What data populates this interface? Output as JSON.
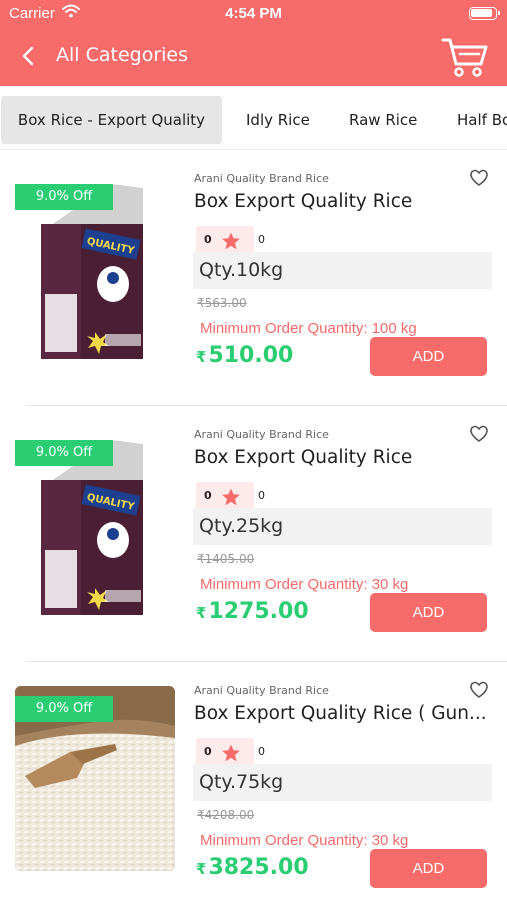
{
  "status_bar": {
    "carrier": "Carrier",
    "time": "4:54 PM"
  },
  "header": {
    "title": "All Categories",
    "back_icon": "chevron-left-icon",
    "cart_icon": "cart-icon",
    "color": "#f76b6a"
  },
  "tabs": [
    {
      "label": "Box Rice - Export Quality",
      "active": true
    },
    {
      "label": "Idly Rice",
      "active": false
    },
    {
      "label": "Raw Rice",
      "active": false
    },
    {
      "label": "Half Bo",
      "active": false
    }
  ],
  "products": [
    {
      "image": "rice-bag-quality",
      "discount": "9.0% Off",
      "brand": "Arani Quality Brand Rice",
      "name": "Box Export Quality Rice",
      "rating_left": "0",
      "rating_right": "0",
      "qty": "Qty.10kg",
      "mrp": "₹563.00",
      "min_order": "Minimum Order Quantity: 100 kg",
      "price_symbol": "₹",
      "price": "510.00",
      "add_label": "ADD"
    },
    {
      "image": "rice-bag-quality",
      "discount": "9.0% Off",
      "brand": "Arani Quality Brand Rice",
      "name": "Box Export Quality Rice",
      "rating_left": "0",
      "rating_right": "0",
      "qty": "Qty.25kg",
      "mrp": "₹1405.00",
      "min_order": "Minimum Order Quantity: 30 kg",
      "price_symbol": "₹",
      "price": "1275.00",
      "add_label": "ADD"
    },
    {
      "image": "rice-sack-scoop",
      "discount": "9.0% Off",
      "brand": "Arani Quality Brand Rice",
      "name": "Box Export Quality Rice ( Gun...",
      "rating_left": "0",
      "rating_right": "0",
      "qty": "Qty.75kg",
      "mrp": "₹4208.00",
      "min_order": "Minimum Order Quantity: 30 kg",
      "price_symbol": "₹",
      "price": "3825.00",
      "add_label": "ADD"
    }
  ],
  "colors": {
    "accent": "#f76b6a",
    "discount": "#2bcd73",
    "price": "#2bcd73"
  }
}
